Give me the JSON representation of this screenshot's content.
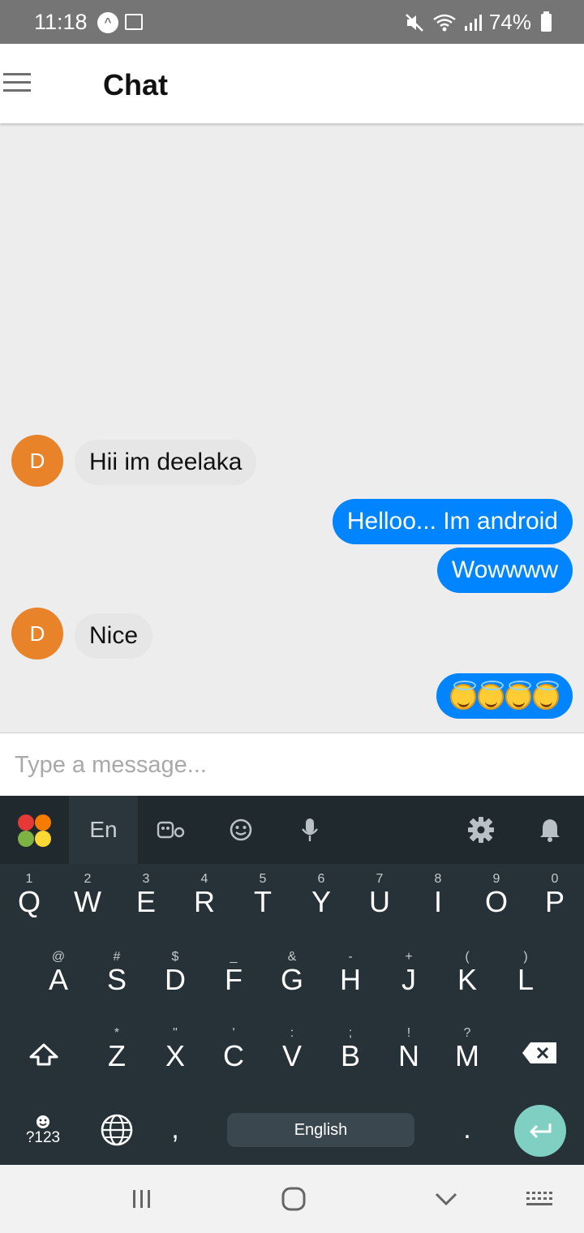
{
  "status_bar": {
    "time": "11:18",
    "battery": "74%",
    "icons": [
      "app-notification-icon",
      "gallery-icon",
      "mute-icon",
      "wifi-icon",
      "signal-icon",
      "battery-icon"
    ]
  },
  "header": {
    "title": "Chat",
    "menu_icon": "hamburger-menu-icon"
  },
  "messages": [
    {
      "sender": "incoming",
      "avatar": "D",
      "text": "Hii im deelaka"
    },
    {
      "sender": "outgoing",
      "text": "Helloo... Im android"
    },
    {
      "sender": "outgoing",
      "text": "Wowwww"
    },
    {
      "sender": "incoming",
      "avatar": "D",
      "text": "Nice"
    },
    {
      "sender": "outgoing",
      "emoji": "smiling-face-with-halo",
      "emoji_count": 4
    }
  ],
  "composer": {
    "placeholder": "Type a message..."
  },
  "keyboard": {
    "toolbar": {
      "lang_tab": "En",
      "icons": [
        "keyboard-logo-icon",
        "sticker-icon",
        "emoji-icon",
        "microphone-icon",
        "settings-icon",
        "notification-bell-icon"
      ]
    },
    "row1": [
      {
        "key": "Q",
        "hint": "1"
      },
      {
        "key": "W",
        "hint": "2"
      },
      {
        "key": "E",
        "hint": "3"
      },
      {
        "key": "R",
        "hint": "4"
      },
      {
        "key": "T",
        "hint": "5"
      },
      {
        "key": "Y",
        "hint": "6"
      },
      {
        "key": "U",
        "hint": "7"
      },
      {
        "key": "I",
        "hint": "8"
      },
      {
        "key": "O",
        "hint": "9"
      },
      {
        "key": "P",
        "hint": "0"
      }
    ],
    "row2": [
      {
        "key": "A",
        "hint": "@"
      },
      {
        "key": "S",
        "hint": "#"
      },
      {
        "key": "D",
        "hint": "$"
      },
      {
        "key": "F",
        "hint": "_"
      },
      {
        "key": "G",
        "hint": "&"
      },
      {
        "key": "H",
        "hint": "-"
      },
      {
        "key": "J",
        "hint": "+"
      },
      {
        "key": "K",
        "hint": "("
      },
      {
        "key": "L",
        "hint": ")"
      }
    ],
    "row3": [
      {
        "key": "Z",
        "hint": "*"
      },
      {
        "key": "X",
        "hint": "\""
      },
      {
        "key": "C",
        "hint": "'"
      },
      {
        "key": "V",
        "hint": ":"
      },
      {
        "key": "B",
        "hint": ";"
      },
      {
        "key": "N",
        "hint": "!"
      },
      {
        "key": "M",
        "hint": "?"
      }
    ],
    "symbols_key": "?123",
    "comma_key": ",",
    "space_label": "English",
    "period_key": "."
  },
  "nav_bar": {
    "icons": [
      "recent-apps-icon",
      "home-icon",
      "back-icon",
      "keyboard-hide-icon"
    ]
  }
}
